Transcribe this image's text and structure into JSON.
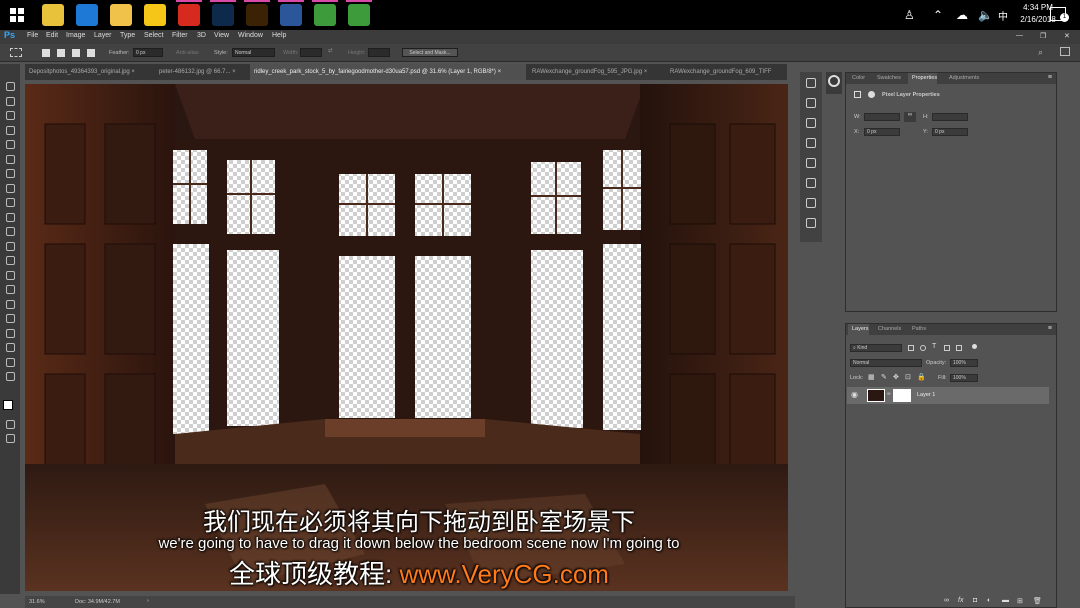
{
  "taskbar": {
    "apps": [
      {
        "name": "chrome-icon",
        "color": "#e8c23a"
      },
      {
        "name": "edge-icon",
        "color": "#1e78d6"
      },
      {
        "name": "file-explorer-icon",
        "color": "#f1c24a"
      },
      {
        "name": "norton-icon",
        "color": "#f5c518"
      },
      {
        "name": "adobe-cc-icon",
        "color": "#d62a1e"
      },
      {
        "name": "photoshop-icon",
        "color": "#0e2a4a"
      },
      {
        "name": "bridge-icon",
        "color": "#3b2205"
      },
      {
        "name": "word-icon",
        "color": "#2b579a"
      },
      {
        "name": "camtasia-icon",
        "color": "#3e9b3c"
      },
      {
        "name": "camtasia-recorder-icon",
        "color": "#3e9b3c"
      }
    ],
    "time": "4:34 PM",
    "date": "2/16/2018",
    "notification_count": "1"
  },
  "menubar": {
    "logo": "Ps",
    "items": [
      "File",
      "Edit",
      "Image",
      "Layer",
      "Type",
      "Select",
      "Filter",
      "3D",
      "View",
      "Window",
      "Help"
    ]
  },
  "options": {
    "feather_label": "Feather:",
    "feather_value": "0 px",
    "antialias_label": "Anti-alias",
    "style_label": "Style:",
    "style_value": "Normal",
    "width_label": "Width:",
    "height_label": "Height:",
    "select_mask_label": "Select and Mask..."
  },
  "tabs": [
    {
      "label": "Depositphotos_49364393_original.jpg"
    },
    {
      "label": "peter-486132.jpg @ 66.7..."
    },
    {
      "label": "ridley_creek_park_stock_5_by_fairiegoodmother-d30ua57.psd @ 31.6% (Layer 1, RGB/8*)"
    },
    {
      "label": "RAWexchange_groundFog_595_JPG.jpg"
    },
    {
      "label": "RAWexchange_groundFog_609_TIFF"
    }
  ],
  "status": {
    "zoom": "31.6%",
    "doc": "Doc: 34.9M/42.7M"
  },
  "properties_panel": {
    "tabs": [
      "Color",
      "Swatches",
      "Properties",
      "Adjustments"
    ],
    "title": "Pixel Layer Properties",
    "w_label": "W:",
    "h_label": "H:",
    "x_label": "X:",
    "x_value": "0 px",
    "y_label": "Y:",
    "y_value": "0 px"
  },
  "layers_panel": {
    "tabs": [
      "Layers",
      "Channels",
      "Paths"
    ],
    "filter_value": "Kind",
    "blend_mode": "Normal",
    "opacity_label": "Opacity:",
    "opacity_value": "100%",
    "lock_label": "Lock:",
    "fill_label": "Fill:",
    "fill_value": "100%",
    "layer_name": "Layer 1",
    "footer_fx": "fx"
  },
  "subtitles": {
    "chinese": "我们现在必须将其向下拖动到卧室场景下",
    "english": "we're going to have to drag it down below the bedroom scene now I'm going to",
    "watermark_prefix": "全球顶级教程:",
    "watermark_url": "www.VeryCG.com",
    "watermark_color": "#ff7a1a"
  }
}
